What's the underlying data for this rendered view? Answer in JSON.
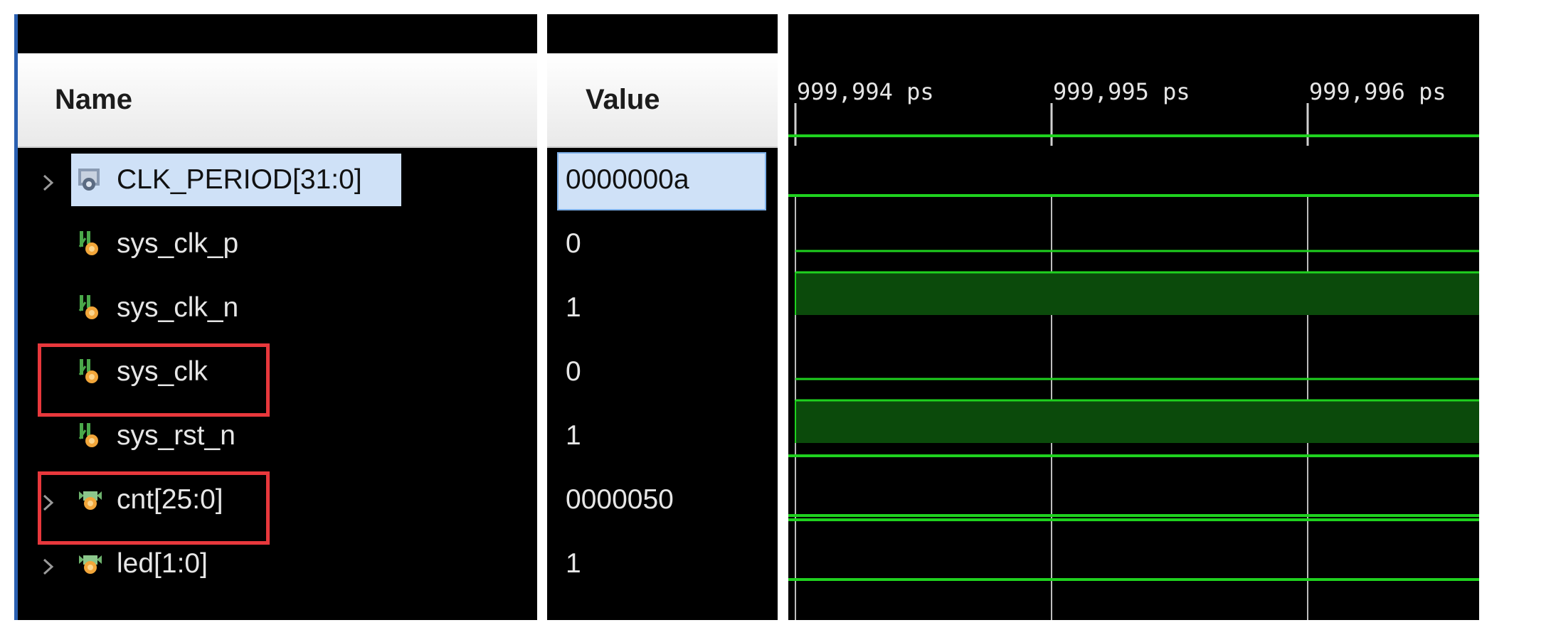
{
  "columns": {
    "name": "Name",
    "value": "Value"
  },
  "signals": [
    {
      "name": "CLK_PERIOD[31:0]",
      "value": "0000000a",
      "expandable": true,
      "selected": true,
      "icon": "parameter-icon",
      "highlighted": false
    },
    {
      "name": "sys_clk_p",
      "value": "0",
      "expandable": false,
      "selected": false,
      "icon": "signal-icon",
      "highlighted": false
    },
    {
      "name": "sys_clk_n",
      "value": "1",
      "expandable": false,
      "selected": false,
      "icon": "signal-icon",
      "highlighted": false
    },
    {
      "name": "sys_clk",
      "value": "0",
      "expandable": false,
      "selected": false,
      "icon": "signal-icon",
      "highlighted": true
    },
    {
      "name": "sys_rst_n",
      "value": "1",
      "expandable": false,
      "selected": false,
      "icon": "signal-icon",
      "highlighted": false
    },
    {
      "name": "cnt[25:0]",
      "value": "0000050",
      "expandable": true,
      "selected": false,
      "icon": "bus-icon",
      "highlighted": true
    },
    {
      "name": "led[1:0]",
      "value": "1",
      "expandable": true,
      "selected": false,
      "icon": "bus-icon",
      "highlighted": false
    }
  ],
  "timeline": {
    "ticks": [
      "999,994 ps",
      "999,995 ps",
      "999,996 ps"
    ]
  },
  "colors": {
    "wave": "#1fd11f",
    "high_fill": "#0b4a0b",
    "selection": "#cfe1f7",
    "highlight": "#e8383c",
    "background": "#000000"
  }
}
